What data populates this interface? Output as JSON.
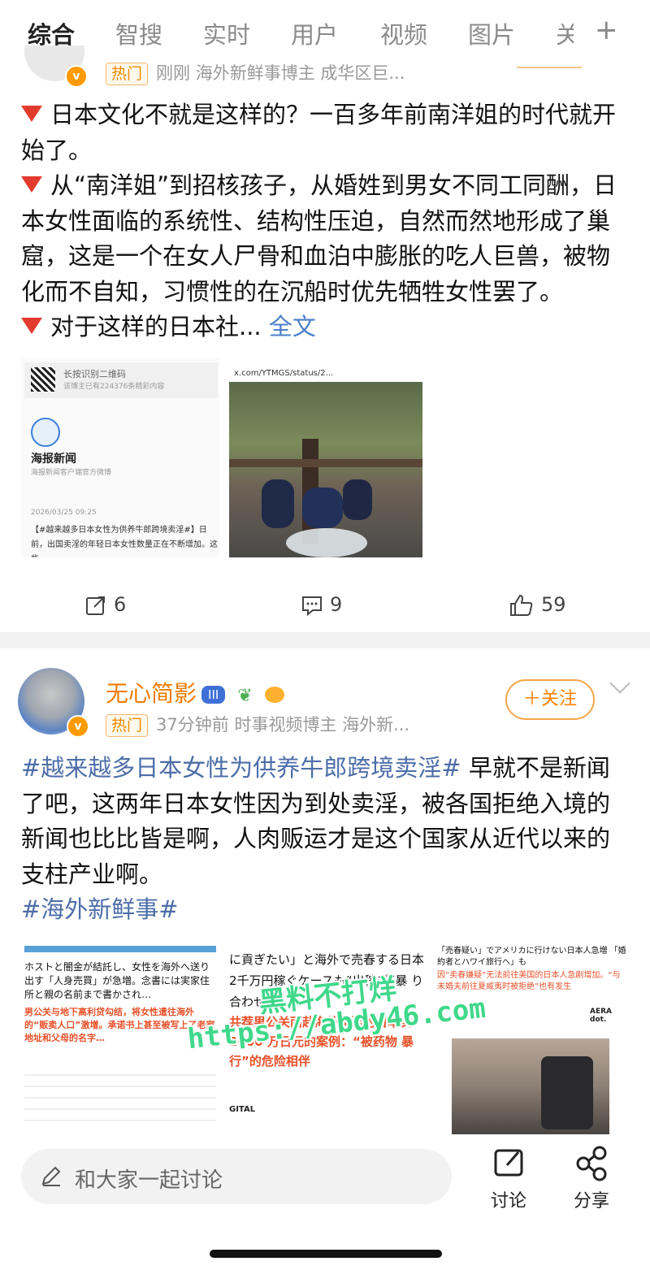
{
  "tabs": [
    "综合",
    "智搜",
    "实时",
    "用户",
    "视频",
    "图片",
    "关"
  ],
  "post1": {
    "badge": "热门",
    "meta": "刚刚  海外新鲜事博主  成华区巨...",
    "line1": "日本文化不就是这样的？一百多年前南洋姐的时代就开始了。",
    "line2": "从“南洋姐”到招核孩子，从婚姓到男女不同工同酬，日本女性面临的系统性、结构性压迫，自然而然地形成了巢窟，这是一个在女人尸骨和血泊中膨胀的吃人巨兽，被物化而不自知，习惯性的在沉船时优先牺牲女性罢了。",
    "line3": "对于这样的日本社...",
    "full_text_link": "全文",
    "img1": {
      "qr_hint": "长按识别二维码",
      "qr_sub": "该博主已有224376条精彩内容",
      "account": "海报新闻",
      "account_sub": "海报新闻客户端官方微博",
      "date": "2026/03/25 09:25",
      "headline": "【#越来越多日本女性为供养牛郎跨境卖淫#】日前，出国卖淫的年轻日本女性数量正在不断增加。这些"
    },
    "img2": {
      "url": "x.com/YTMGS/status/2..."
    },
    "actions": {
      "share": "6",
      "comment": "9",
      "like": "59"
    }
  },
  "post2": {
    "username": "无心简影",
    "level": "III",
    "badge": "热门",
    "meta": "37分钟前  时事视频博主  海外新...",
    "follow": "＋关注",
    "hashtag1": "#越来越多日本女性为供养牛郎跨境卖淫#",
    "body": " 早就不是新闻了吧，这两年日本女性因为到处卖淫，被各国拒绝入境的新闻也比比皆是啊，人肉贩运才是这个国家从近代以来的支柱产业啊。",
    "hashtag2": "#海外新鲜事#",
    "img1": {
      "jp": "ホストと闇金が結託し、女性を海外へ送り出す「人身売買」が急増。念書には実家住所と親の名前まで書かされ…",
      "cn": "男公关与地下高利贷勾结，将女性遣往海外的“贩卖人口”激增。承诺书上甚至被写上了老家地址和父母的名字…"
    },
    "img2": {
      "jp": "に貢ぎたい」と海外で売春する日本 2千万円稼ぐケースも“出稼ぎ”暴 り合わせ",
      "cn": "共荐男公关而赴海外卖淫的日本女 2000 万日元的案例：“被药物 暴行”的危险相伴",
      "tag": "GITAL"
    },
    "img3": {
      "jp": "「売春疑い」でアメリカに行けない日本人急増 「婚約者とハワイ旅行へ」も",
      "cn": "因“卖春嫌疑”无法前往美国的日本人急剧增加。“与未婚夫前往夏威夷时被拒绝”也有发生",
      "logo": "AERA dot."
    }
  },
  "watermark": {
    "line1": "黑料不打烊",
    "line2": "https://abdy46.com"
  },
  "bottom": {
    "input_placeholder": "和大家一起讨论",
    "discuss": "讨论",
    "share": "分享"
  }
}
